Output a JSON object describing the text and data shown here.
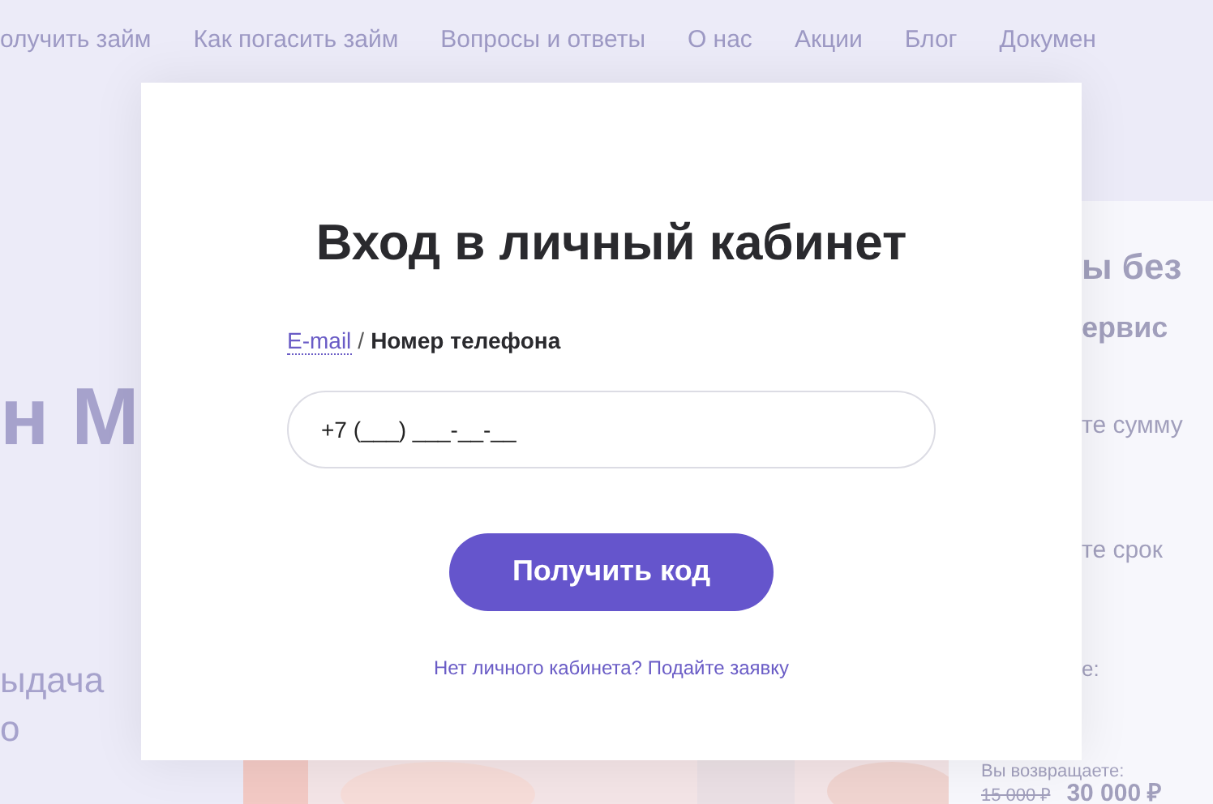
{
  "nav": [
    "олучить займ",
    "Как погасить займ",
    "Вопросы и ответы",
    "О нас",
    "Акции",
    "Блог",
    "Докумен"
  ],
  "hero": {
    "title": "н М",
    "subtitle_lines": [
      "ыдача",
      "о"
    ]
  },
  "calculator": {
    "title": "ы без",
    "subtitle": "ервис",
    "amount_label": "те сумму",
    "term_label": "те срок",
    "note": "е:",
    "return_label": "Вы возвращаете:",
    "old_price": "15 000 ₽",
    "price": "30 000 ₽"
  },
  "modal": {
    "title": "Вход в личный кабинет",
    "tabs": [
      {
        "label": "E-mail",
        "selected": false
      },
      {
        "label": "Номер телефона",
        "selected": true
      }
    ],
    "separator": "/",
    "phone_field": {
      "value": "+7 (___) ___-__-__"
    },
    "submit": "Получить код",
    "register_link": "Нет личного кабинета? Подайте заявку"
  }
}
